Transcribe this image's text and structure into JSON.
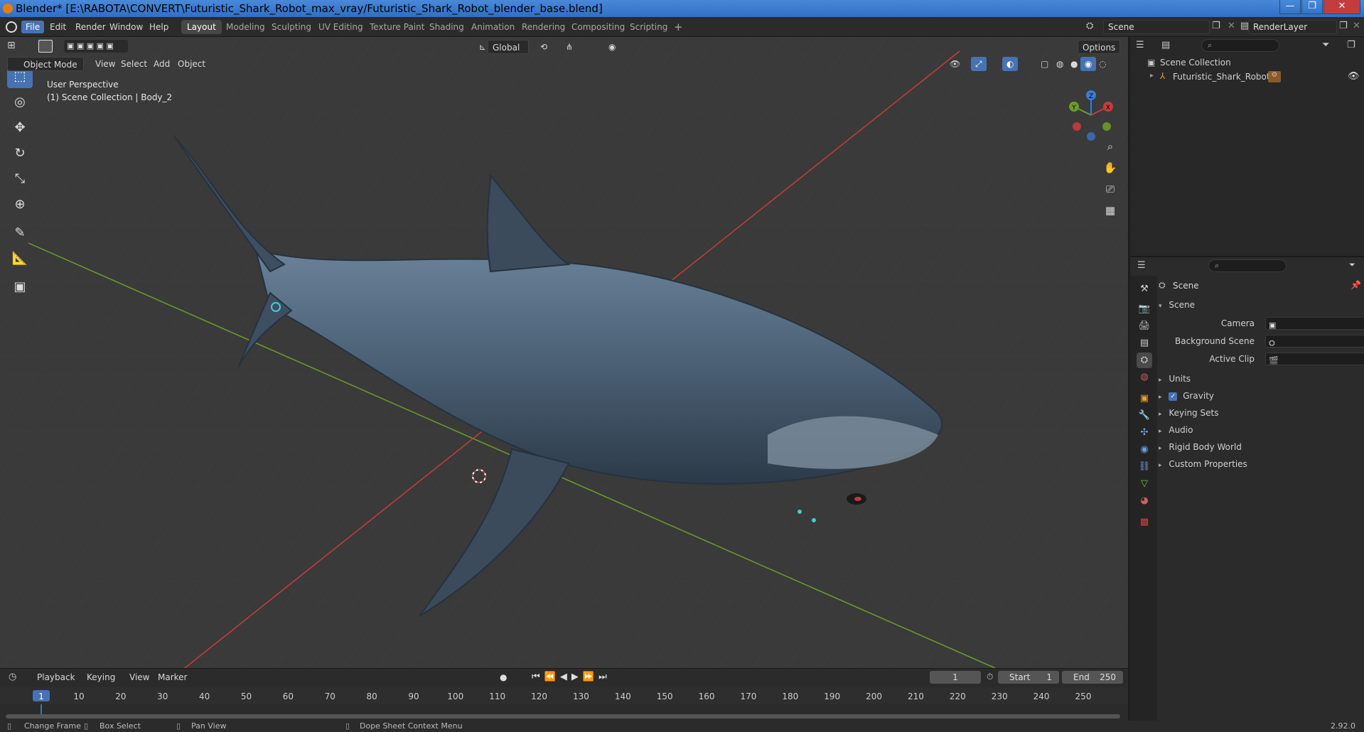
{
  "window": {
    "title": "Blender* [E:\\RABOTA\\CONVERT\\Futuristic_Shark_Robot_max_vray/Futuristic_Shark_Robot_blender_base.blend]",
    "minimize": "—",
    "maximize": "❐",
    "close": "✕"
  },
  "menubar": {
    "items": [
      "File",
      "Edit",
      "Render",
      "Window",
      "Help"
    ],
    "workspaces": [
      "Layout",
      "Modeling",
      "Sculpting",
      "UV Editing",
      "Texture Paint",
      "Shading",
      "Animation",
      "Rendering",
      "Compositing",
      "Scripting"
    ],
    "add_workspace": "+",
    "scene": "Scene",
    "view_layer": "RenderLayer"
  },
  "viewport": {
    "mode": "Object Mode",
    "menus": [
      "View",
      "Select",
      "Add",
      "Object"
    ],
    "orientation": "Global",
    "options_label": "Options",
    "perspective_text": "User Perspective",
    "collection_text": "(1) Scene Collection | Body_2",
    "gizmo_labels": {
      "z": "Z",
      "y": "Y",
      "x": "X"
    }
  },
  "outliner": {
    "root": "Scene Collection",
    "items": [
      {
        "label": "Futuristic_Shark_Robot"
      }
    ]
  },
  "properties": {
    "context": "Scene",
    "panel_title": "Scene",
    "fields": [
      {
        "label": "Camera"
      },
      {
        "label": "Background Scene"
      },
      {
        "label": "Active Clip"
      }
    ],
    "sections": [
      "Units",
      "Gravity",
      "Keying Sets",
      "Audio",
      "Rigid Body World",
      "Custom Properties"
    ],
    "gravity_checked": true
  },
  "timeline": {
    "menus": [
      "Playback",
      "Keying",
      "View",
      "Marker"
    ],
    "current_frame": "1",
    "start_label": "Start",
    "start": "1",
    "end_label": "End",
    "end": "250",
    "ticks": [
      "1",
      "10",
      "20",
      "30",
      "40",
      "50",
      "60",
      "70",
      "80",
      "90",
      "100",
      "110",
      "120",
      "130",
      "140",
      "150",
      "160",
      "170",
      "180",
      "190",
      "200",
      "210",
      "220",
      "230",
      "240",
      "250"
    ]
  },
  "statusbar": {
    "items": [
      "Change Frame",
      "Box Select",
      "Pan View",
      "Dope Sheet Context Menu"
    ],
    "version": "2.92.0"
  },
  "colors": {
    "accent": "#4772b3",
    "x_axis": "#c83c3c",
    "y_axis": "#6a9c2a",
    "shark_body": "#4a5f74"
  }
}
